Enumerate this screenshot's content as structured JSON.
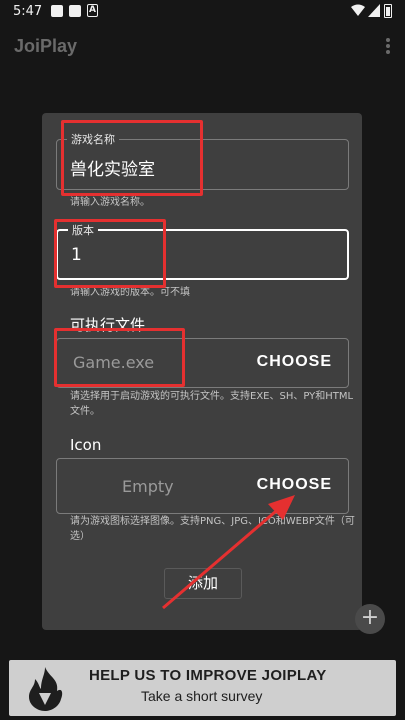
{
  "status_bar": {
    "time": "5:47",
    "indicator_a": "A",
    "icons": [
      "notification-square-icon",
      "notification-square-icon",
      "a-notification-icon",
      "wifi-icon",
      "signal-icon",
      "battery-icon"
    ]
  },
  "app_bar": {
    "title": "JoiPlay",
    "menu_icon": "more-vert-icon"
  },
  "dialog": {
    "name_field": {
      "label": "游戏名称",
      "value": "兽化实验室",
      "helper": "请输入游戏名称。"
    },
    "version_field": {
      "label": "版本",
      "value": "1",
      "helper": "请输入游戏的版本。可不填"
    },
    "executable": {
      "label": "可执行文件",
      "placeholder": "Game.exe",
      "button": "CHOOSE",
      "helper": "请选择用于启动游戏的可执行文件。支持EXE、SH、PY和HTML文件。"
    },
    "icon": {
      "label": "Icon",
      "placeholder": "Empty",
      "button": "CHOOSE",
      "helper": "请为游戏图标选择图像。支持PNG、JPG、ICO和WEBP文件（可选）"
    },
    "add_button": "添加"
  },
  "fab": {
    "icon": "plus-icon",
    "symbol": "+"
  },
  "banner": {
    "headline": "HELP US TO IMPROVE JOIPLAY",
    "subline": "Take a short survey",
    "logo_icon": "joiplay-flame-icon"
  },
  "colors": {
    "background": "#161616",
    "dialog": "#3f3f3f",
    "annotation": "#e53030",
    "banner": "#cfcfcf"
  }
}
